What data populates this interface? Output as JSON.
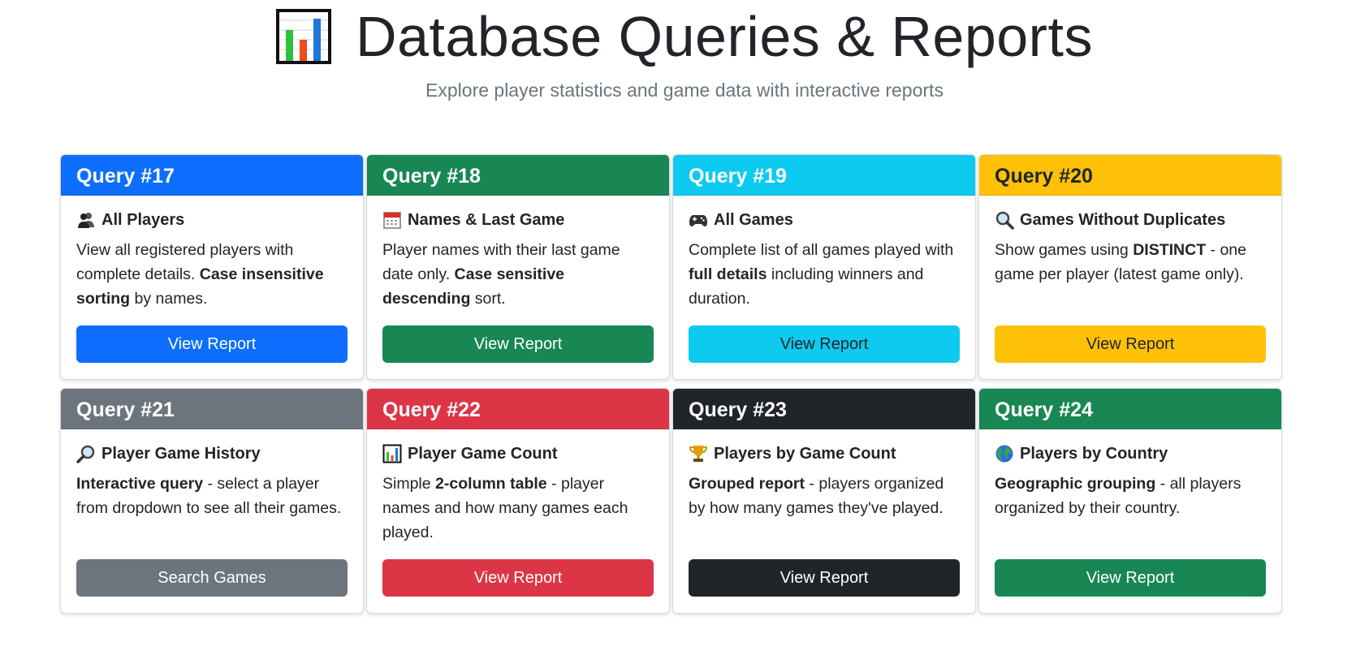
{
  "header": {
    "title": "Database Queries & Reports",
    "subtitle": "Explore player statistics and game data with interactive reports",
    "icon": "bar-chart-icon"
  },
  "cards": [
    {
      "header": "Query #17",
      "color": "#0d6efd",
      "header_text_color": "#ffffff",
      "icon": "busts-icon",
      "title": "All Players",
      "text_parts": [
        {
          "t": "View all registered players with complete details. ",
          "b": false
        },
        {
          "t": "Case insensitive sorting",
          "b": true
        },
        {
          "t": " by names.",
          "b": false
        }
      ],
      "button": "View Report",
      "button_text_color": "#ffffff"
    },
    {
      "header": "Query #18",
      "color": "#198754",
      "header_text_color": "#ffffff",
      "icon": "calendar-icon",
      "title": "Names & Last Game",
      "text_parts": [
        {
          "t": "Player names with their last game date only. ",
          "b": false
        },
        {
          "t": "Case sensitive descending",
          "b": true
        },
        {
          "t": " sort.",
          "b": false
        }
      ],
      "button": "View Report",
      "button_text_color": "#ffffff"
    },
    {
      "header": "Query #19",
      "color": "#0dcaf0",
      "header_text_color": "#ffffff",
      "icon": "game-controller-icon",
      "title": "All Games",
      "text_parts": [
        {
          "t": "Complete list of all games played with ",
          "b": false
        },
        {
          "t": "full details",
          "b": true
        },
        {
          "t": " including winners and duration.",
          "b": false
        }
      ],
      "button": "View Report",
      "button_text_color": "#212529"
    },
    {
      "header": "Query #20",
      "color": "#ffc107",
      "header_text_color": "#212529",
      "icon": "magnifier-left-icon",
      "title": "Games Without Duplicates",
      "text_parts": [
        {
          "t": "Show games using ",
          "b": false
        },
        {
          "t": "DISTINCT",
          "b": true
        },
        {
          "t": " - one game per player (latest game only).",
          "b": false
        }
      ],
      "button": "View Report",
      "button_text_color": "#212529"
    },
    {
      "header": "Query #21",
      "color": "#6c757d",
      "header_text_color": "#ffffff",
      "icon": "magnifier-right-icon",
      "title": "Player Game History",
      "text_parts": [
        {
          "t": "Interactive query",
          "b": true
        },
        {
          "t": " - select a player from dropdown to see all their games.",
          "b": false
        }
      ],
      "button": "Search Games",
      "button_text_color": "#ffffff"
    },
    {
      "header": "Query #22",
      "color": "#dc3545",
      "header_text_color": "#ffffff",
      "icon": "bar-chart-icon",
      "title": "Player Game Count",
      "text_parts": [
        {
          "t": "Simple ",
          "b": false
        },
        {
          "t": "2-column table",
          "b": true
        },
        {
          "t": " - player names and how many games each played.",
          "b": false
        }
      ],
      "button": "View Report",
      "button_text_color": "#ffffff"
    },
    {
      "header": "Query #23",
      "color": "#212529",
      "header_text_color": "#ffffff",
      "icon": "trophy-icon",
      "title": "Players by Game Count",
      "text_parts": [
        {
          "t": "Grouped report",
          "b": true
        },
        {
          "t": " - players organized by how many games they've played.",
          "b": false
        }
      ],
      "button": "View Report",
      "button_text_color": "#ffffff"
    },
    {
      "header": "Query #24",
      "color": "#198754",
      "header_text_color": "#ffffff",
      "icon": "globe-icon",
      "title": "Players by Country",
      "text_parts": [
        {
          "t": "Geographic grouping",
          "b": true
        },
        {
          "t": " - all players organized by their country.",
          "b": false
        }
      ],
      "button": "View Report",
      "button_text_color": "#ffffff"
    }
  ]
}
